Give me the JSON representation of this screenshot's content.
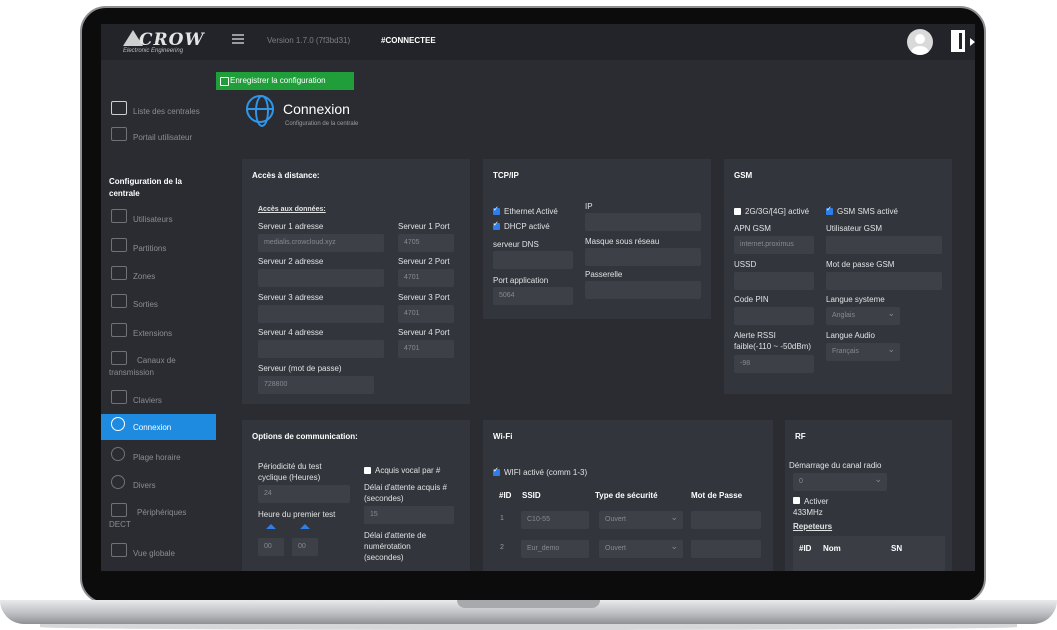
{
  "colors": {
    "accent": "#1e8be0",
    "save": "#1f9e3a",
    "panel": "#32353b",
    "screen": "#2a2c31"
  },
  "topbar": {
    "logo_text": "CROW",
    "logo_sub": "Electronic Engineering",
    "version": "Version 1.7.0 (7f3bd31)",
    "status": "#CONNECTEE",
    "avatar_icon": "user-avatar-icon",
    "logout_icon": "logout-icon"
  },
  "sidebar": {
    "top_items": [
      {
        "label": "Liste des centrales",
        "icon": "list-icon"
      },
      {
        "label": "Portail utilisateur",
        "icon": "calendar-icon"
      }
    ],
    "section_heading": "Configuration de la centrale",
    "items": [
      {
        "label": "Utilisateurs",
        "icon": "users-icon"
      },
      {
        "label": "Partitions",
        "icon": "lock-icon"
      },
      {
        "label": "Zones",
        "icon": "zone-icon"
      },
      {
        "label": "Sorties",
        "icon": "toggle-icon"
      },
      {
        "label": "Extensions",
        "icon": "extension-icon"
      },
      {
        "label": "Canaux de transmission",
        "icon": "transmission-icon"
      },
      {
        "label": "Claviers",
        "icon": "keypad-icon"
      },
      {
        "label": "Connexion",
        "icon": "globe-icon"
      },
      {
        "label": "Plage horaire",
        "icon": "clock-icon"
      },
      {
        "label": "Divers",
        "icon": "settings-icon"
      },
      {
        "label": "Périphériques DECT",
        "icon": "dect-icon"
      },
      {
        "label": "Vue globale",
        "icon": "chart-icon"
      }
    ]
  },
  "main": {
    "save_label": "Enregistrer la configuration",
    "title": "Connexion",
    "subtitle": "Configuration de la centrale"
  },
  "remote": {
    "title": "Accès à distance:",
    "data_access": "Accès aux données:",
    "server1_addr_label": "Serveur 1 adresse",
    "server1_addr": "medialis.crowcloud.xyz",
    "server1_port_label": "Serveur 1 Port",
    "server1_port": "4705",
    "server2_addr_label": "Serveur 2 adresse",
    "server2_port_label": "Serveur 2 Port",
    "server2_port": "4701",
    "server3_addr_label": "Serveur 3 adresse",
    "server3_port_label": "Serveur 3 Port",
    "server3_port": "4701",
    "server4_addr_label": "Serveur 4 adresse",
    "server4_port_label": "Serveur 4 Port",
    "server4_port": "4701",
    "password_label": "Serveur (mot de passe)",
    "password": "728800"
  },
  "tcpip": {
    "title": "TCP/IP",
    "ethernet": "Ethernet Activé",
    "dhcp": "DHCP activé",
    "ip_label": "IP",
    "dns_label": "serveur DNS",
    "mask_label": "Masque sous réseau",
    "port_label": "Port application",
    "port": "5064",
    "gateway_label": "Passerelle"
  },
  "gsm": {
    "title": "GSM",
    "gen_label": "2G/3G/[4G] activé",
    "sms_label": "GSM SMS activé",
    "apn_label": "APN GSM",
    "apn": "internet.proximus",
    "user_label": "Utilisateur GSM",
    "ussd_label": "USSD",
    "pwd_label": "Mot de passe GSM",
    "pin_label": "Code PIN",
    "lang_sys_label": "Langue systeme",
    "lang_sys": "Anglais",
    "rssi_label_1": "Alerte RSSI",
    "rssi_label_2": "faible(-110 ~ -50dBm)",
    "rssi": "-98",
    "lang_audio_label": "Langue Audio",
    "lang_audio": "Français"
  },
  "comm": {
    "title": "Options de communication:",
    "period_label_1": "Périodicité du test",
    "period_label_2": "cyclique (Heures)",
    "period": "24",
    "first_test_label": "Heure du premier test",
    "hour": "00",
    "minute": "00",
    "vocal_label": "Acquis vocal par #",
    "delay_ack_label_1": "Délai d'attente acquis #",
    "delay_ack_label_2": "(secondes)",
    "delay_ack": "15",
    "delay_redial_label_1": "Délai d'attente de",
    "delay_redial_label_2": "numérotation",
    "delay_redial_label_3": "(secondes)"
  },
  "wifi": {
    "title": "Wi-Fi",
    "enabled_label": "WIFI activé (comm 1-3)",
    "headers": [
      "#ID",
      "SSID",
      "Type de sécurité",
      "Mot de Passe"
    ],
    "rows": [
      {
        "id": "1",
        "ssid": "C10-55",
        "security": "Ouvert"
      },
      {
        "id": "2",
        "ssid": "Eur_demo",
        "security": "Ouvert"
      }
    ]
  },
  "rf": {
    "title": "RF",
    "channel_label": "Démarrage du canal radio",
    "channel": "0",
    "activate_label_1": "Activer",
    "activate_label_2": "433MHz",
    "repeaters_label": "Repeteurs",
    "headers": [
      "#ID",
      "Nom",
      "SN"
    ]
  }
}
